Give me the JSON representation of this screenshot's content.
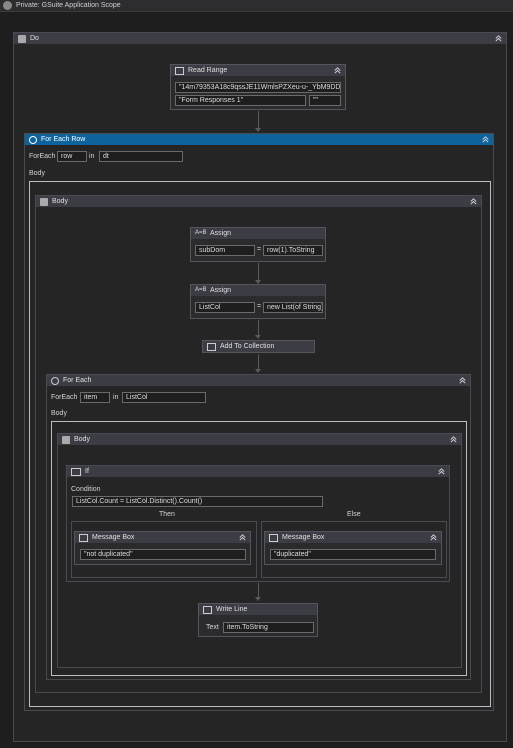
{
  "window_title": "Private: GSuite Application Scope",
  "do_seq": {
    "title": "Do"
  },
  "read_range": {
    "title": "Read Range",
    "spreadsheet_id": "\"14m79353A18c9qssJE11WmlsPZXeu-u-_YbM9DDX",
    "sheet": "\"Form Responses 1\"",
    "range": "\"\""
  },
  "for_each_row": {
    "title": "For Each Row",
    "foreach_label": "ForEach",
    "var": "row",
    "in_label": "in",
    "collection": "dt",
    "body_label": "Body"
  },
  "body_seq": {
    "title": "Body"
  },
  "assign1": {
    "title": "Assign",
    "to": "subDom",
    "eq": "=",
    "value": "row(1).ToString"
  },
  "assign2": {
    "title": "Assign",
    "to": "ListCol",
    "eq": "=",
    "value": "new List(of String)"
  },
  "add_to_collection": {
    "title": "Add To Collection"
  },
  "for_each": {
    "title": "For Each",
    "foreach_label": "ForEach",
    "var": "item",
    "in_label": "in",
    "collection": "ListCol",
    "body_label": "Body"
  },
  "inner_body": {
    "title": "Body"
  },
  "if_act": {
    "title": "If",
    "condition_label": "Condition",
    "condition": "ListCol.Count = ListCol.Distinct().Count()",
    "then_label": "Then",
    "else_label": "Else"
  },
  "msg_then": {
    "title": "Message Box",
    "text": "\"not duplicated\""
  },
  "msg_else": {
    "title": "Message Box",
    "text": "\"duplicated\""
  },
  "write_line": {
    "title": "Write Line",
    "text_label": "Text",
    "text": "item.ToString"
  },
  "colors": {
    "accent": "#0e639c",
    "bg": "#1e1e1e",
    "header": "#3c3c44"
  }
}
